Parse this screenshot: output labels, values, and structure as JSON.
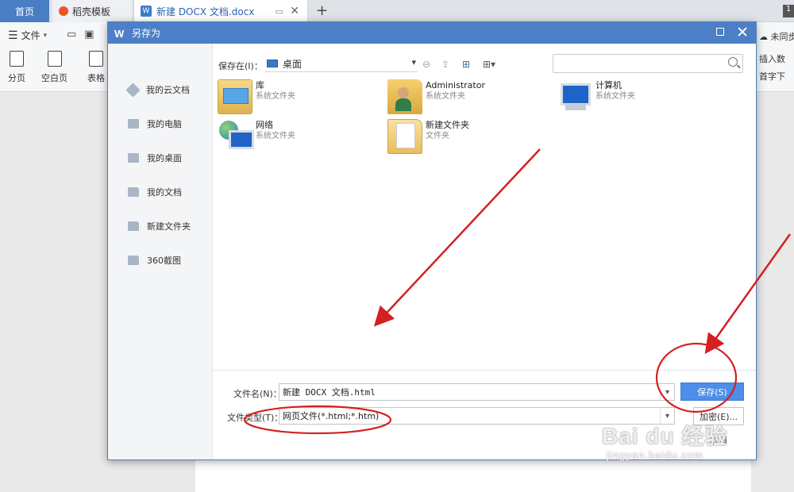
{
  "tabs": {
    "home": "首页",
    "daoke": "稻壳模板",
    "doc": "新建 DOCX 文档.docx",
    "plus": "+",
    "corner": "1"
  },
  "toolbar": {
    "file_menu": "文件",
    "btn_fenye": "分页",
    "btn_kongbaiye": "空白页",
    "btn_biaoge": "表格",
    "sync": "未同步",
    "insert_table": "插入数",
    "first_line": "首字下"
  },
  "dialog": {
    "title": "另存为",
    "sidebar": [
      "我的云文档",
      "我的电脑",
      "我的桌面",
      "我的文档",
      "新建文件夹",
      "360截图"
    ],
    "save_in_label": "保存在(I)：",
    "save_in_value": "桌面",
    "search_placeholder": "",
    "files": [
      {
        "name": "库",
        "sub": "系统文件夹",
        "icon": "library-icon"
      },
      {
        "name": "Administrator",
        "sub": "系统文件夹",
        "icon": "user-folder-icon"
      },
      {
        "name": "计算机",
        "sub": "系统文件夹",
        "icon": "computer-icon"
      },
      {
        "name": "网络",
        "sub": "系统文件夹",
        "icon": "network-icon"
      },
      {
        "name": "新建文件夹",
        "sub": "文件夹",
        "icon": "folder-icon"
      }
    ],
    "filename_label": "文件名(N)：",
    "filename_value": "新建 DOCX 文档.html",
    "filetype_label": "文件类型(T)：",
    "filetype_value": "网页文件(*.html;*.htm)",
    "save_button": "保存(S)",
    "encrypt_button": "加密(E)...",
    "cancel_button": "取消"
  },
  "watermark": {
    "main": "Bai du 经验",
    "sub": "jingyan.baidu.com"
  },
  "annotation_color": "#d42020",
  "accent_color": "#4d7fc6"
}
